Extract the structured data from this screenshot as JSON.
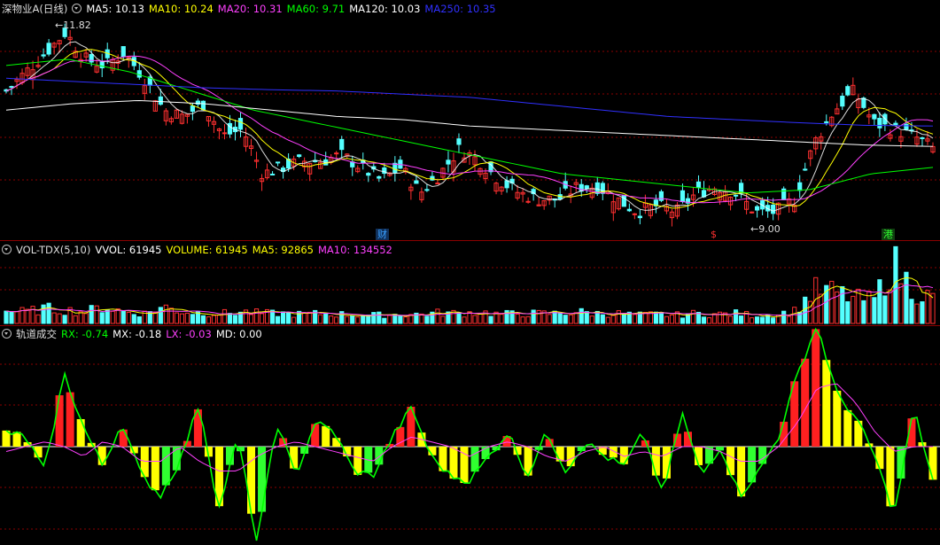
{
  "price_panel": {
    "title": "深物业A(日线)",
    "indicators": [
      {
        "label": "MA5: 10.13",
        "color": "#ffffff"
      },
      {
        "label": "MA10: 10.24",
        "color": "#ffff00"
      },
      {
        "label": "MA20: 10.31",
        "color": "#ff40ff"
      },
      {
        "label": "MA60: 9.71",
        "color": "#00ff00"
      },
      {
        "label": "MA120: 10.03",
        "color": "#ffffff"
      },
      {
        "label": "MA250: 10.35",
        "color": "#3030ff"
      }
    ],
    "high_label": "11.82",
    "low_label": "9.00",
    "markers": [
      {
        "text": "财",
        "color": "#3aa0ff"
      },
      {
        "text": "$",
        "color": "#ff3030"
      },
      {
        "text": "港",
        "color": "#30ff30"
      }
    ]
  },
  "volume_panel": {
    "title": "VOL-TDX(5,10)",
    "indicators": [
      {
        "label": "VVOL: 61945",
        "color": "#ffffff"
      },
      {
        "label": "VOLUME: 61945",
        "color": "#ffff00"
      },
      {
        "label": "MA5: 92865",
        "color": "#ffff00"
      },
      {
        "label": "MA10: 134552",
        "color": "#ff40ff"
      }
    ]
  },
  "track_panel": {
    "title": "轨道成交",
    "indicators": [
      {
        "label": "RX: -0.74",
        "color": "#00ff00"
      },
      {
        "label": "MX: -0.18",
        "color": "#ffffff"
      },
      {
        "label": "LX: -0.03",
        "color": "#ff40ff"
      },
      {
        "label": "MD: 0.00",
        "color": "#ffffff"
      }
    ]
  },
  "colors": {
    "up": "#ff3030",
    "down": "#54ffff",
    "grid": "#8b0000",
    "ma5": "#ffffff",
    "ma10": "#ffff00",
    "ma20": "#ff40ff",
    "ma60": "#00ff00",
    "ma120": "#ffffff",
    "ma250": "#3030ff"
  },
  "chart_data": {
    "type": "candlestick",
    "price_anchors": [
      10.9,
      11.2,
      11.5,
      11.82,
      11.4,
      11.3,
      11.5,
      11.1,
      10.6,
      10.5,
      10.7,
      10.2,
      10.3,
      9.6,
      9.7,
      9.8,
      9.8,
      9.9,
      9.7,
      9.5,
      9.7,
      9.3,
      9.6,
      10.0,
      9.8,
      9.5,
      9.3,
      9.2,
      9.2,
      9.4,
      9.4,
      9.2,
      9.0,
      9.1,
      9.0,
      9.3,
      9.4,
      9.3,
      9.0,
      9.0,
      9.2,
      10.1,
      10.6,
      10.9,
      10.4,
      10.3,
      10.2,
      10.0
    ],
    "volume_anchors": [
      15,
      14,
      18,
      16,
      14,
      20,
      14,
      12,
      20,
      14,
      13,
      12,
      14,
      12,
      12,
      11,
      12,
      11,
      10,
      10,
      11,
      11,
      13,
      12,
      14,
      11,
      12,
      12,
      12,
      14,
      12,
      12,
      10,
      11,
      10,
      12,
      11,
      12,
      10,
      11,
      15,
      40,
      38,
      30,
      28,
      72,
      40,
      30
    ],
    "track_anchors": [
      0.3,
      0.2,
      -0.5,
      1.5,
      0.4,
      -0.4,
      0.5,
      -0.6,
      -1.0,
      -0.3,
      0.9,
      -1.3,
      0.2,
      -2.0,
      0.5,
      -0.6,
      0.5,
      0.3,
      -0.5,
      -0.6,
      0.2,
      0.8,
      -0.2,
      -0.6,
      -0.7,
      -0.2,
      0.3,
      -0.6,
      0.3,
      -0.5,
      0.1,
      -0.2,
      -0.4,
      0.3,
      -1.0,
      0.7,
      -0.6,
      0.0,
      -1.0,
      -0.5,
      0.2,
      1.5,
      2.5,
      1.1,
      0.6,
      -0.2,
      -1.4,
      0.8,
      -0.7
    ],
    "track_ma_anchors": [
      -0.1,
      0.0,
      0.1,
      0.0,
      -0.2,
      0.1,
      0.0,
      -0.3,
      -0.3,
      0.0,
      -0.3,
      -0.5,
      -0.5,
      -0.2,
      0.0,
      0.1,
      0.0,
      -0.1,
      -0.2,
      -0.3,
      0.0,
      0.2,
      0.1,
      0.0,
      -0.2,
      0.0,
      0.1,
      0.0,
      -0.2,
      -0.3,
      -0.1,
      0.0,
      -0.2,
      -0.1,
      -0.2,
      0.0,
      0.0,
      -0.1,
      -0.3,
      -0.3,
      0.0,
      0.5,
      1.2,
      1.3,
      0.9,
      0.3,
      -0.1,
      0.0,
      0.0
    ]
  }
}
